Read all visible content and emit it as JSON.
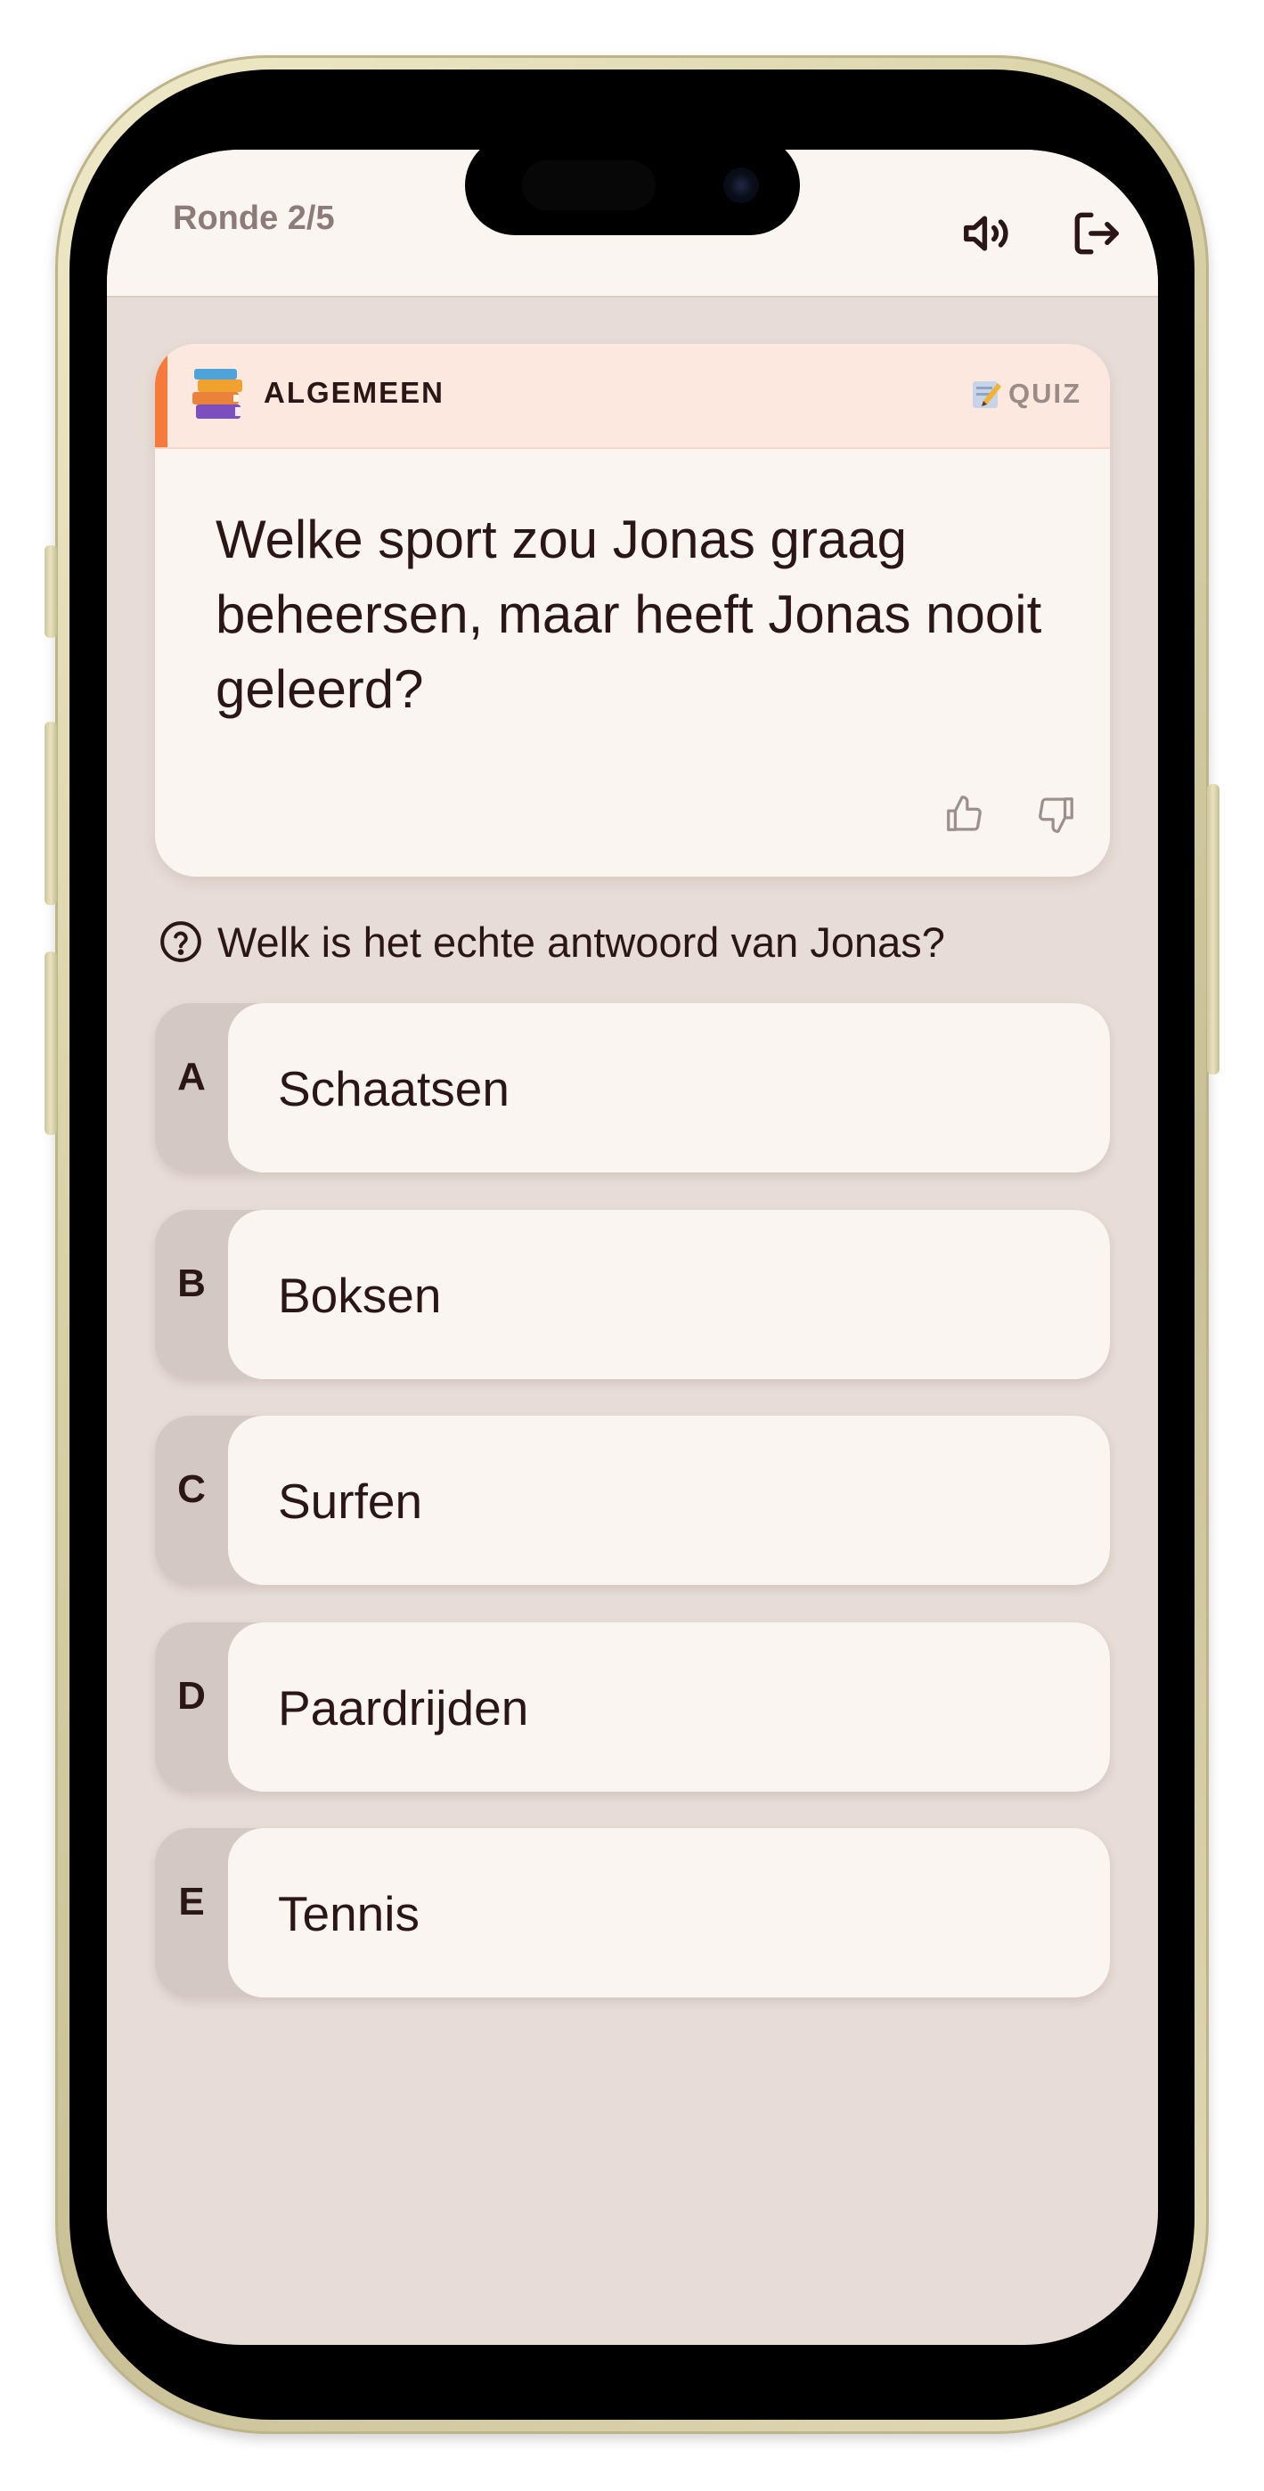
{
  "header": {
    "round": "Ronde 2/5",
    "icons": [
      "speaker-icon",
      "exit-icon"
    ]
  },
  "question_card": {
    "category": "ALGEMEEN",
    "category_icon": "books-icon",
    "mode": "QUIZ",
    "mode_icon": "memo-icon",
    "question": "Welke sport zou Jonas graag beheersen, maar heeft Jonas nooit geleerd?",
    "accent_color": "#f57a3c"
  },
  "prompt": {
    "text": "Welk is het echte antwoord van Jonas?",
    "icon": "question-circle-icon"
  },
  "answers": [
    {
      "letter": "A",
      "text": "Schaatsen"
    },
    {
      "letter": "B",
      "text": "Boksen"
    },
    {
      "letter": "C",
      "text": "Surfen"
    },
    {
      "letter": "D",
      "text": "Paardrijden"
    },
    {
      "letter": "E",
      "text": "Tennis"
    }
  ],
  "colors": {
    "background": "#e7dcd6",
    "card": "#faf5f1",
    "text": "#2a1715",
    "header_tint": "#fde8df"
  }
}
